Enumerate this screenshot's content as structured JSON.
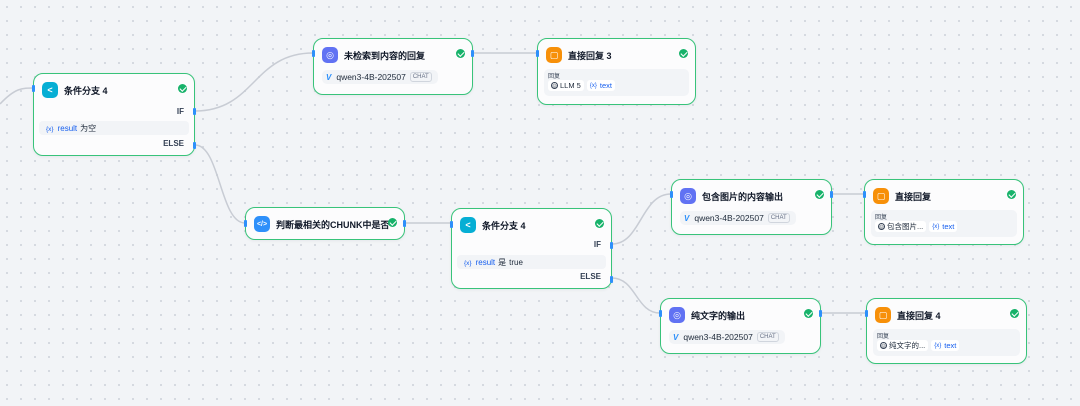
{
  "nodes": {
    "cond_a": {
      "title": "条件分支 4",
      "if_label": "IF",
      "else_label": "ELSE",
      "cond_var": "result",
      "cond_op": "为空"
    },
    "llm_a": {
      "title": "未检索到内容的回复",
      "model": "qwen3-4B-202507",
      "model_tag": "CHAT"
    },
    "reply_a": {
      "title": "直接回复 3",
      "caption": "回复",
      "chip_ref": "LLM 5",
      "chip_var": "text"
    },
    "code_a": {
      "title": "判断最相关的CHUNK中是否"
    },
    "cond_b": {
      "title": "条件分支 4",
      "if_label": "IF",
      "else_label": "ELSE",
      "cond_var": "result",
      "cond_op": "是",
      "cond_value": "true"
    },
    "llm_b": {
      "title": "包含图片的内容输出",
      "model": "qwen3-4B-202507",
      "model_tag": "CHAT"
    },
    "reply_b": {
      "title": "直接回复",
      "caption": "回复",
      "chip_ref": "包含图片...",
      "chip_var": "text"
    },
    "llm_c": {
      "title": "纯文字的输出",
      "model": "qwen3-4B-202507",
      "model_tag": "CHAT"
    },
    "reply_c": {
      "title": "直接回复 4",
      "caption": "回复",
      "chip_ref": "纯文字的...",
      "chip_var": "text"
    }
  },
  "var_badge": "{x}",
  "icons": {
    "condition": "branch-icon",
    "llm": "llm-icon",
    "reply": "reply-icon",
    "code": "code-icon",
    "status": "check-circle-icon",
    "model": "model-brand-icon"
  },
  "colors": {
    "success": "#17b26a",
    "node_border": "#38c37a",
    "edge": "#c8ccd4",
    "handle": "#2e90fa",
    "condition_icon": "#06aed4",
    "llm_icon": "#6172f3",
    "reply_icon": "#f79009",
    "code_icon": "#2e90fa",
    "variable": "#155eef"
  }
}
